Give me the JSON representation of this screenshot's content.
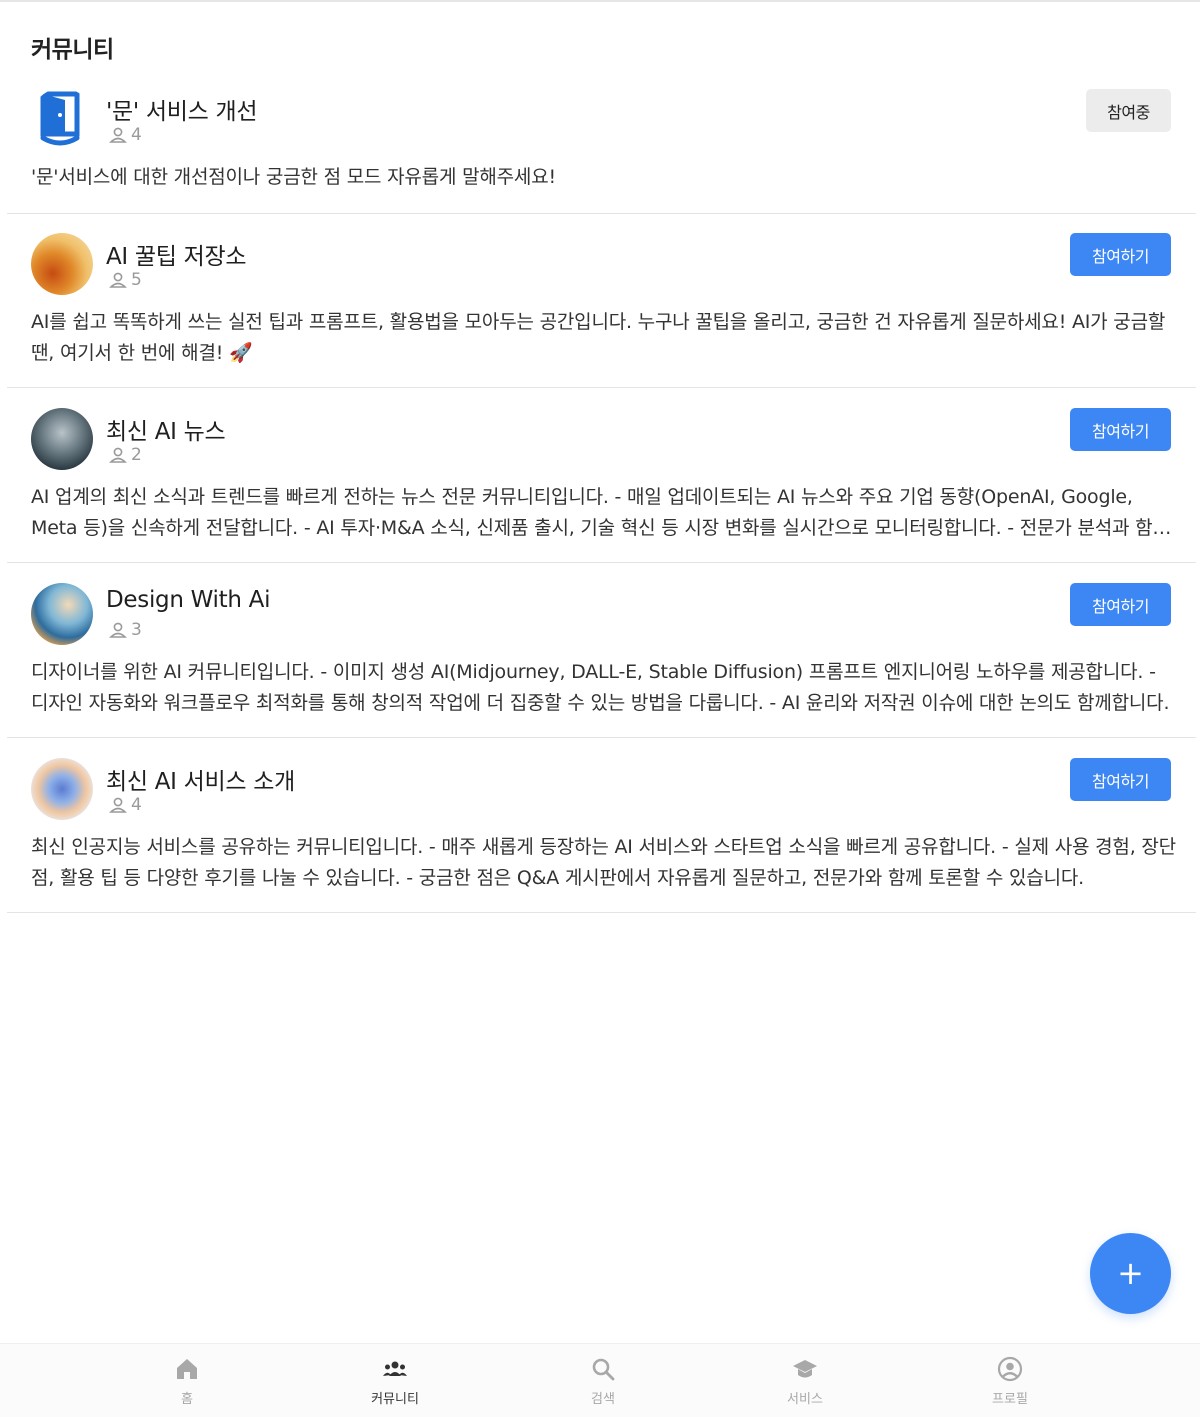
{
  "page": {
    "title": "커뮤니티"
  },
  "communities": [
    {
      "name": "'문' 서비스 개선",
      "members": "4",
      "description": "'문'서비스에 대한 개선점이나 궁금한 점 모드 자유롭게 말해주세요!",
      "button_label": "참여중",
      "joined": true,
      "avatar_icon": "door-logo-icon"
    },
    {
      "name": "AI 꿀팁 저장소",
      "members": "5",
      "description": "AI를 쉽고 똑똑하게 쓰는 실전 팁과 프롬프트, 활용법을 모아두는 공간입니다. 누구나 꿀팁을 올리고, 궁금한 건 자유롭게 질문하세요! AI가 궁금할 땐, 여기서 한 번에 해결! 🚀",
      "button_label": "참여하기",
      "joined": false,
      "avatar_icon": "honey-photo-icon"
    },
    {
      "name": "최신 AI 뉴스",
      "members": "2",
      "description": "AI 업계의 최신 소식과 트렌드를 빠르게 전하는 뉴스 전문 커뮤니티입니다. - 매일 업데이트되는 AI 뉴스와 주요 기업 동향(OpenAI, Google, Meta 등)을 신속하게 전달합니다. - AI 투자·M&A 소식, 신제품 출시, 기술 혁신 등 시장 변화를 실시간으로 모니터링합니다. - 전문가 분석과 함께 깊이 있는 인사이트를 제공합니다.",
      "button_label": "참여하기",
      "joined": false,
      "avatar_icon": "robots-illustration-icon"
    },
    {
      "name": "Design With Ai",
      "members": "3",
      "description": "디자이너를 위한 AI 커뮤니티입니다. - 이미지 생성 AI(Midjourney, DALL-E, Stable Diffusion) 프롬프트 엔지니어링 노하우를 제공합니다. - 디자인 자동화와 워크플로우 최적화를 통해 창의적 작업에 더 집중할 수 있는 방법을 다룹니다. - AI 윤리와 저작권 이슈에 대한 논의도 함께합니다.",
      "button_label": "참여하기",
      "joined": false,
      "avatar_icon": "designer-illustration-icon"
    },
    {
      "name": "최신 AI 서비스 소개",
      "members": "4",
      "description": "최신 인공지능 서비스를 공유하는 커뮤니티입니다. - 매주 새롭게 등장하는 AI 서비스와 스타트업 소식을 빠르게 공유합니다. - 실제 사용 경험, 장단점, 활용 팁 등 다양한 후기를 나눌 수 있습니다. - 궁금한 점은 Q&A 게시판에서 자유롭게 질문하고, 전문가와 함께 토론할 수 있습니다.",
      "button_label": "참여하기",
      "joined": false,
      "avatar_icon": "people-illustration-icon"
    }
  ],
  "fab": {
    "label": "+",
    "icon": "plus-icon"
  },
  "bottom_nav": [
    {
      "label": "홈",
      "icon": "home-icon",
      "active": false
    },
    {
      "label": "커뮤니티",
      "icon": "people-icon",
      "active": true
    },
    {
      "label": "검색",
      "icon": "search-icon",
      "active": false
    },
    {
      "label": "서비스",
      "icon": "graduation-cap-icon",
      "active": false
    },
    {
      "label": "프로필",
      "icon": "user-circle-icon",
      "active": false
    }
  ],
  "colors": {
    "accent": "#3d87f5",
    "joined_bg": "#ececec",
    "muted": "#9a9a9a"
  }
}
